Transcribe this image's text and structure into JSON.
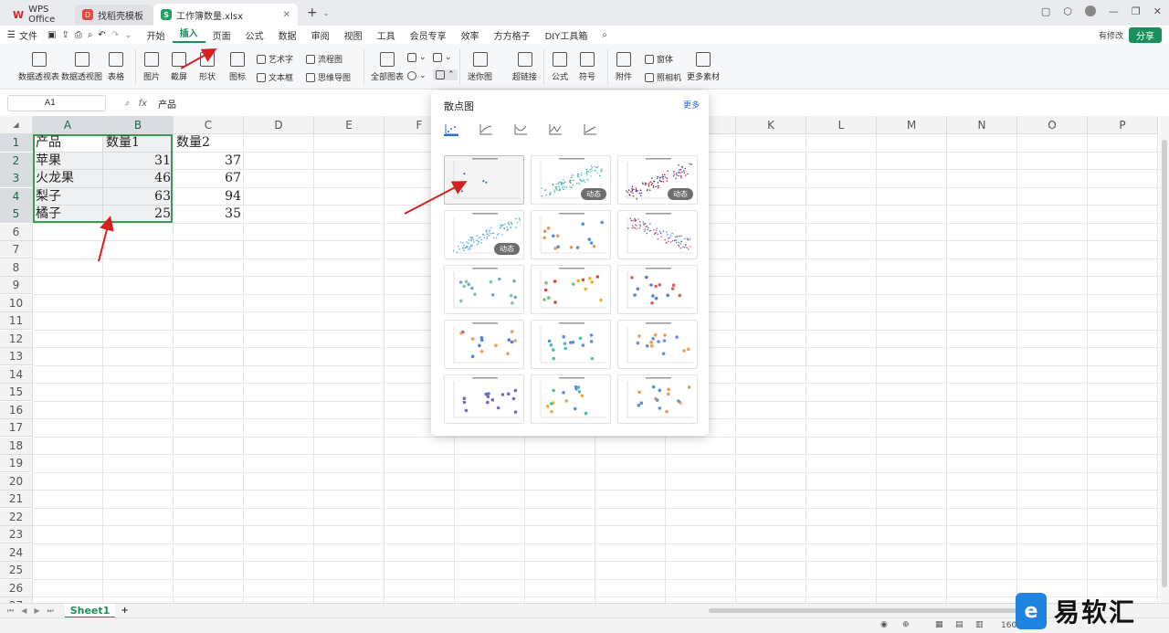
{
  "tabs": [
    {
      "label": "WPS Office",
      "icon": "wps-logo-icon"
    },
    {
      "label": "找稻壳模板",
      "icon": "docer-logo-icon"
    },
    {
      "label": "工作簿数量.xlsx",
      "icon": "spreadsheet-logo-icon",
      "active": true
    }
  ],
  "menu": {
    "file_label": "文件",
    "items": [
      "开始",
      "插入",
      "页面",
      "公式",
      "数据",
      "审阅",
      "视图",
      "工具",
      "会员专享",
      "效率",
      "方方格子",
      "DIY工具箱"
    ],
    "active": "插入",
    "has_changes": "有修改",
    "share": "分享"
  },
  "ribbon": {
    "pivot_table": "数据透视表",
    "pivot_chart": "数据透视图",
    "table": "表格",
    "picture": "图片",
    "screenshot": "截屏",
    "shape": "形状",
    "icon": "图标",
    "art_text": "艺术字",
    "flowchart": "流程图",
    "textbox": "文本框",
    "mindmap": "思维导图",
    "all_charts": "全部图表",
    "sparkline": "迷你图",
    "hyperlink": "超链接",
    "formula": "公式",
    "symbol": "符号",
    "attachment": "附件",
    "form": "窗体",
    "camera": "照相机",
    "more_materials": "更多素材"
  },
  "formula_bar": {
    "cell_ref": "A1",
    "value": "产品"
  },
  "sheet": {
    "columns": [
      "A",
      "B",
      "C",
      "D",
      "E",
      "F",
      "G",
      "H",
      "I",
      "J",
      "K",
      "L",
      "M",
      "N",
      "O",
      "P"
    ],
    "rows": [
      "1",
      "2",
      "3",
      "4",
      "5",
      "6",
      "7",
      "8",
      "9",
      "10",
      "11",
      "12",
      "13",
      "14",
      "15",
      "16",
      "17",
      "18",
      "19",
      "20",
      "21",
      "22",
      "23",
      "24",
      "25",
      "26",
      "27"
    ],
    "data": [
      [
        "产品",
        "数量1",
        "数量2"
      ],
      [
        "苹果",
        "31",
        "37"
      ],
      [
        "火龙果",
        "46",
        "67"
      ],
      [
        "梨子",
        "63",
        "94"
      ],
      [
        "橘子",
        "25",
        "35"
      ]
    ]
  },
  "sheet_tabs": {
    "active": "Sheet1"
  },
  "status": {
    "zoom": "160"
  },
  "scatter_dropdown": {
    "title": "散点图",
    "more": "更多",
    "dynamic_badge": "动态"
  },
  "watermark": {
    "text": "易软汇"
  }
}
